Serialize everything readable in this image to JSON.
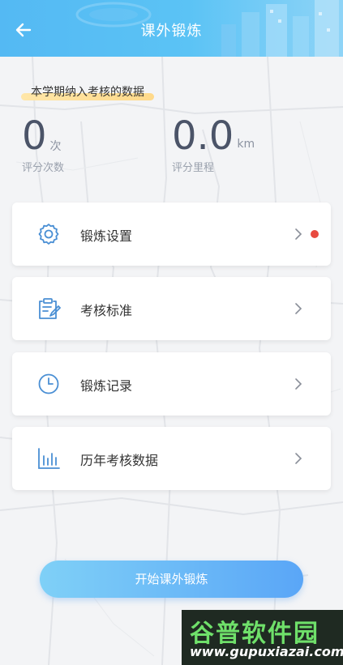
{
  "header": {
    "title": "课外锻炼",
    "back_icon": "arrow-left-icon",
    "color_start": "#54b9f3",
    "color_end": "#8fd4f7"
  },
  "stats": {
    "tag": "本学期纳入考核的数据",
    "count": {
      "value": "0",
      "unit": "次",
      "label": "评分次数"
    },
    "distance": {
      "value": "0.0",
      "unit": "km",
      "label": "评分里程"
    }
  },
  "menu": {
    "items": [
      {
        "label": "锻炼设置",
        "icon": "gear-icon",
        "has_badge": true
      },
      {
        "label": "考核标准",
        "icon": "clipboard-edit-icon",
        "has_badge": false
      },
      {
        "label": "锻炼记录",
        "icon": "clock-icon",
        "has_badge": false
      },
      {
        "label": "历年考核数据",
        "icon": "bar-chart-icon",
        "has_badge": false
      }
    ],
    "badge_color": "#e84a3f",
    "icon_color": "#4a8fd4"
  },
  "start_button": {
    "label": "开始课外锻炼"
  },
  "watermark": {
    "title": "谷普软件园",
    "url": "www.gupuxiazai.com"
  }
}
